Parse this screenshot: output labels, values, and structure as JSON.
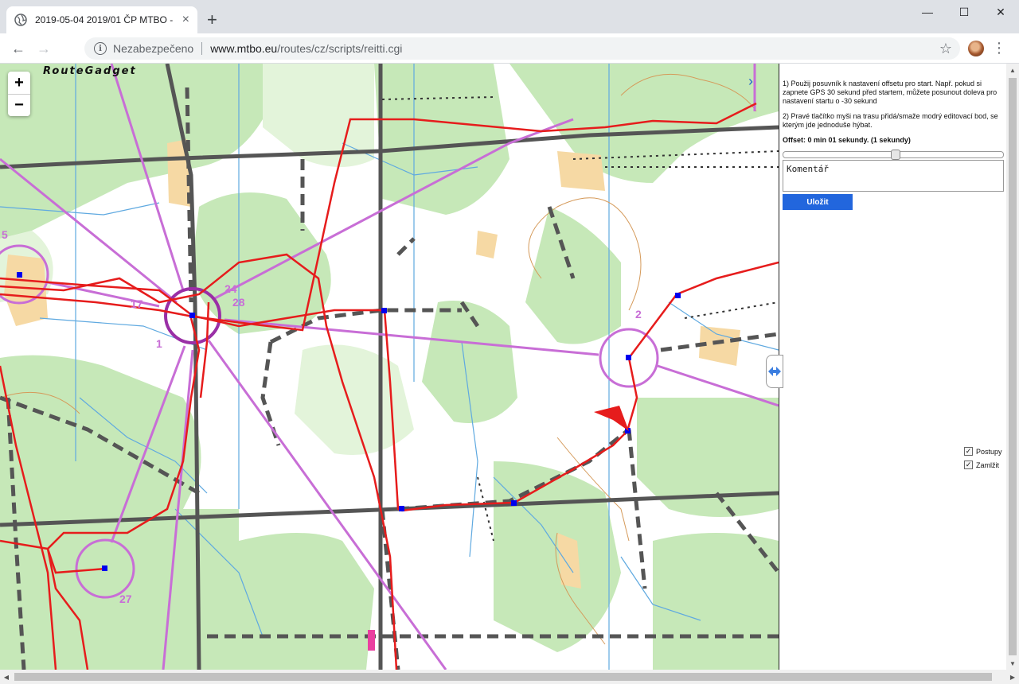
{
  "browser": {
    "tab_title": "2019-05-04 2019/01 ČP MTBO -",
    "tab_close": "×",
    "new_tab": "+",
    "window_minimize": "—",
    "window_maximize": "☐",
    "window_close": "✕",
    "back": "←",
    "forward": "→",
    "security_label": "Nezabezpečeno",
    "url_host": "www.mtbo.eu",
    "url_path": "/routes/cz/scripts/reitti.cgi",
    "bookmark": "☆",
    "menu": "⋮"
  },
  "map": {
    "logo": "RouteGadget",
    "zoom_in": "+",
    "zoom_out": "−",
    "panel_toggle": "›",
    "control_labels": [
      {
        "text": "5"
      },
      {
        "text": "17"
      },
      {
        "text": "24"
      },
      {
        "text": "28"
      },
      {
        "text": "1"
      },
      {
        "text": "2"
      },
      {
        "text": "27"
      }
    ],
    "colors": {
      "forest": "#c6e8b8",
      "course": "#c86ed6",
      "route": "#e61c1c",
      "edit_point": "#0000ee",
      "road": "#555555"
    }
  },
  "panel": {
    "instruction_1": "1) Použij posuvník k nastavení offsetu pro start. Např. pokud si zapnete GPS 30 sekund před startem, můžete posunout doleva pro nastavení startu o -30 sekund",
    "instruction_2": "2) Pravé tlačítko myši na trasu přidá/smaže modrý editovací bod, se kterým jde jednoduše hýbat.",
    "offset_label": "Offset: 0 min 01 sekundy. (1 sekundy)",
    "offset_slider_fraction": 0.51,
    "comment_value": "Komentář",
    "save_label": "Uložit",
    "checkbox_legs": "Postupy",
    "checkbox_hide": "Zamlžit",
    "check_mark": "✓"
  },
  "scroll": {
    "up": "▲",
    "down": "▼",
    "left": "◀",
    "right": "▶"
  }
}
